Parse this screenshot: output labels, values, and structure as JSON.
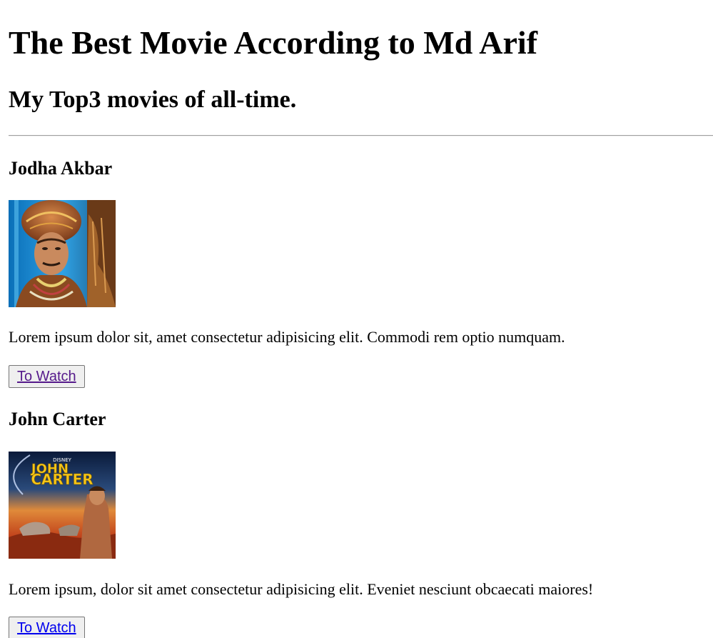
{
  "page": {
    "title": "The Best Movie According to Md Arif",
    "subtitle": "My Top3 movies of all-time."
  },
  "movies": [
    {
      "name": "Jodha Akbar",
      "image_alt": "Jodha Akbar poster",
      "description": "Lorem ipsum dolor sit, amet consectetur adipisicing elit. Commodi rem optio numquam.",
      "button_label": "To Watch",
      "link_color": "#551a8b"
    },
    {
      "name": "John Carter",
      "image_alt": "John Carter poster",
      "poster_text": {
        "brand": "DISNEY",
        "line1": "JOHN",
        "line2": "CARTER"
      },
      "description": "Lorem ipsum, dolor sit amet consectetur adipisicing elit. Eveniet nesciunt obcaecati maiores!",
      "button_label": "To Watch",
      "link_color": "#0000ee"
    }
  ]
}
